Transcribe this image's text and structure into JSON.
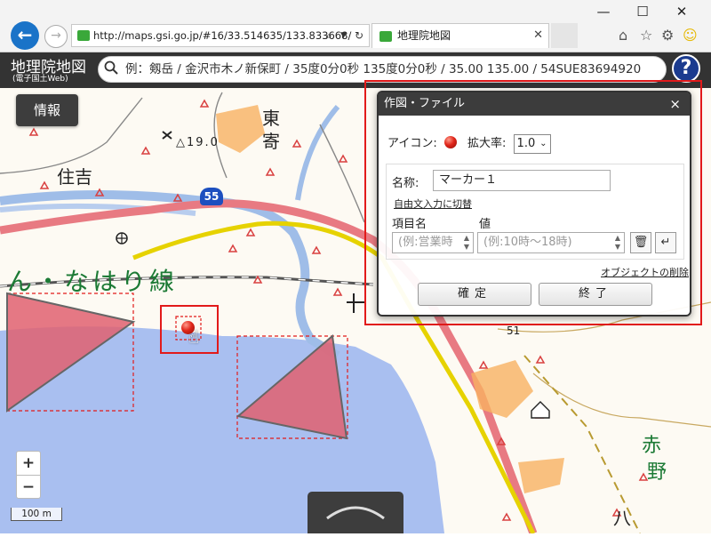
{
  "browser": {
    "url": "http://maps.gsi.go.jp/#16/33.514635/133.833668/",
    "tab_title": "地理院地図",
    "window_buttons": [
      "—",
      "☐",
      "✕"
    ]
  },
  "header": {
    "logo_main": "地理院地図",
    "logo_sub": "(電子国土Web)",
    "search_placeholder": "例：剱岳 / 金沢市木ノ新保町 / 35度0分0秒 135度0分0秒 / 35.00 135.00 / 54SUE83694920",
    "help_label": "?"
  },
  "map": {
    "info_button": "情報",
    "zoom_in": "+",
    "zoom_out": "−",
    "scale": "100 m",
    "labels": {
      "sumiyoshi": "住吉",
      "higashi1": "東",
      "higashi2": "寄",
      "elev1": "△19.0",
      "elev2": "51",
      "route": "55",
      "railway": "ん・なはり線",
      "aka": "赤",
      "no": "野",
      "ha": "八"
    }
  },
  "dialog": {
    "title": "作図・ファイル",
    "close": "×",
    "icon_label": "アイコン:",
    "scale_label": "拡大率:",
    "scale_value": "1.0",
    "name_label": "名称:",
    "name_value": "マーカー１",
    "free_text_link": "自由文入力に切替",
    "item_name_header": "項目名",
    "value_header": "値",
    "item_placeholder": "(例:営業時",
    "value_placeholder": "(例:10時〜18時)",
    "delete_icon": "🗑",
    "enter_icon": "↵",
    "delete_object_link": "オブジェクトの削除",
    "confirm_button": "確定",
    "end_button": "終了"
  }
}
